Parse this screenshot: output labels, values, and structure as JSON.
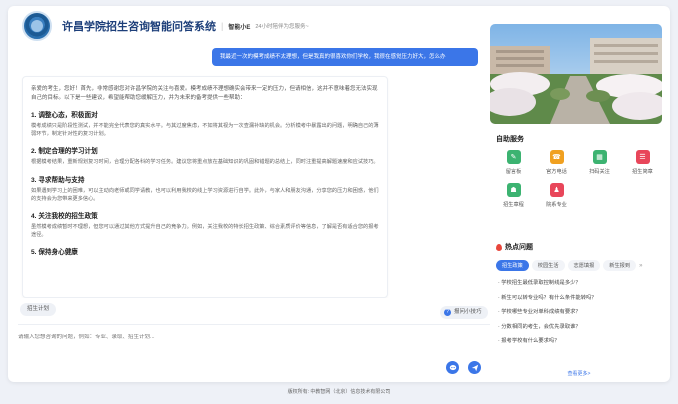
{
  "header": {
    "title": "许昌学院招生咨询智能问答系统",
    "badge": "智能小E",
    "subtitle": "24小时陪伴为您服务~"
  },
  "chat": {
    "user_message": "我最近一次的模考成绩不太理想，但是我真的很喜欢你们学校，我很在感觉压力好大，怎么办",
    "answer_intro": "亲爱的考生，您好！首先，非常感谢您对许昌学院的关注与喜爱。模考成绩不理想确实会带来一定的压力，但请相信，这并不意味着您无法实现自己的目标。以下是一些建议，希望能帮助您缓解压力，并为未来的备考提供一些帮助：",
    "sections": [
      {
        "title": "1. 调整心态，积极面对",
        "text": "模考成绩只是阶段性测试，并不能完全代表您的真实水平。与其过度焦虑，不如将其视为一次查漏补缺的机会。分析模考中暴露出的问题，明确自己的薄弱环节，制定针对性的复习计划。"
      },
      {
        "title": "2. 制定合理的学习计划",
        "text": "根据模考结果，重新规划复习时间，合理分配各科的学习任务。建议您将重点放在基础知识的巩固和错题的总结上，同时注重提高解题速度和应试技巧。"
      },
      {
        "title": "3. 寻求帮助与支持",
        "text": "如果遇到学习上的困难，可以主动向老师或同学请教，也可以利用我校的线上学习资源进行自学。此外，与家人和朋友沟通，分享您的压力和困惑，他们的支持会为您带来更多信心。"
      },
      {
        "title": "4. 关注我校的招生政策",
        "text": "虽然模考成绩暂时不理想，但您可以通过其他方式提升自己的竞争力。例如，关注我校的特长招生政策、综合素质评价等信息，了解是否有适合您的报考途径。"
      },
      {
        "title": "5. 保持身心健康",
        "text": ""
      }
    ],
    "chip_left": "招生计划",
    "chip_right": "报问小技巧",
    "chip_right_icon": "?",
    "input_placeholder": "请输入您想咨询的问题，例如：专业、录取、招生计划..."
  },
  "services": {
    "heading": "自助服务",
    "items": [
      {
        "label": "留言板",
        "icon": "message-board-icon",
        "color": "#3cb371",
        "glyph": "✎"
      },
      {
        "label": "官方电话",
        "icon": "phone-icon",
        "color": "#f0a020",
        "glyph": "☎"
      },
      {
        "label": "扫码关注",
        "icon": "qr-code-icon",
        "color": "#3cb371",
        "glyph": "▦"
      },
      {
        "label": "招生简章",
        "icon": "brochure-icon",
        "color": "#e8465a",
        "glyph": "☰"
      },
      {
        "label": "招生章程",
        "icon": "admission-rules-icon",
        "color": "#3cb371",
        "glyph": "☗"
      },
      {
        "label": "院系专业",
        "icon": "departments-icon",
        "color": "#e8465a",
        "glyph": "♟"
      }
    ]
  },
  "hot": {
    "heading": "热点问题",
    "tabs": [
      "招生政策",
      "校园生活",
      "志愿填报",
      "新生报到"
    ],
    "active_tab": 0,
    "questions": [
      "学校招生最低录取控制线是多少？",
      "新生可以转专业吗？有什么条件能转吗？",
      "学校哪些专业对单科成绩有要求？",
      "分数相同的考生，会优先录取谁？",
      "报考学校有什么要求吗？"
    ],
    "more": "查看更多>"
  },
  "footer": "版权所有: 中教智网（北京）信息技术有限公司",
  "colors": {
    "accent": "#3b76e8",
    "title": "#1d3f7a"
  }
}
